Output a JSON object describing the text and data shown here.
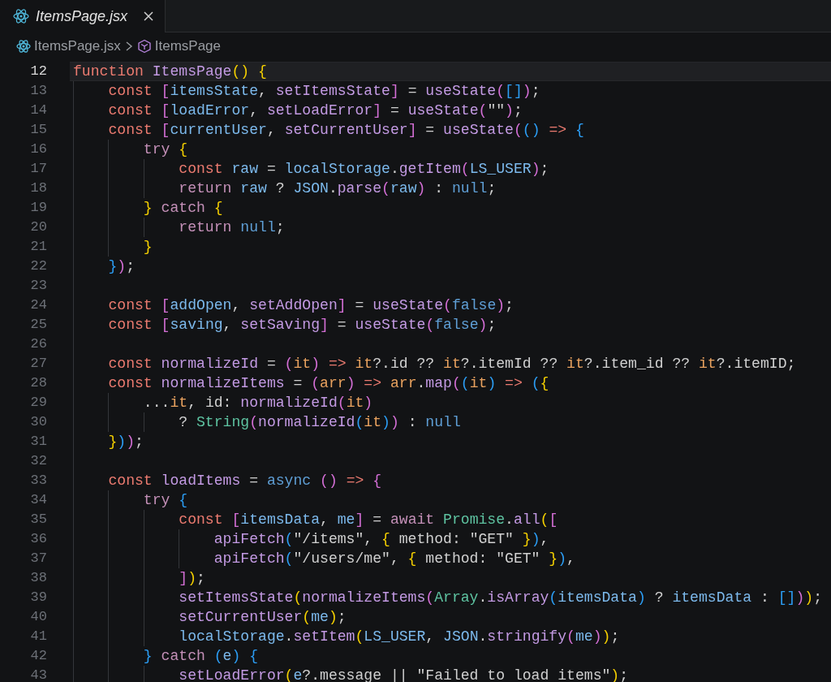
{
  "tab": {
    "title": "ItemsPage.jsx",
    "preview": true,
    "selected": true
  },
  "breadcrumb": [
    {
      "text": "ItemsPage.jsx",
      "kind": "file"
    },
    {
      "text": "ItemsPage",
      "kind": "function"
    }
  ],
  "editor": {
    "lines": [
      {
        "number": "12",
        "current": true,
        "tokens": [
          {
            "text": "function",
            "kind": "kw"
          },
          {
            "text": " ItemsPage",
            "kind": "fn"
          },
          {
            "text": "()",
            "kind": "b1"
          },
          {
            "text": " {",
            "kind": "b1"
          }
        ]
      },
      {
        "number": "13",
        "current": false,
        "tokens": [
          {
            "text": "    const",
            "kind": "kw"
          },
          {
            "text": " [",
            "kind": "b2"
          },
          {
            "text": "itemsState",
            "kind": "var"
          },
          {
            "text": ", ",
            "kind": "plain"
          },
          {
            "text": "setItemsState",
            "kind": "fn"
          },
          {
            "text": "]",
            "kind": "b2"
          },
          {
            "text": " = ",
            "kind": "plain"
          },
          {
            "text": "useState",
            "kind": "fn"
          },
          {
            "text": "(",
            "kind": "b2"
          },
          {
            "text": "[]",
            "kind": "b3"
          },
          {
            "text": ")",
            "kind": "b2"
          },
          {
            "text": ";",
            "kind": "plain"
          }
        ]
      },
      {
        "number": "14",
        "current": false,
        "tokens": [
          {
            "text": "    const",
            "kind": "kw"
          },
          {
            "text": " [",
            "kind": "b2"
          },
          {
            "text": "loadError",
            "kind": "var"
          },
          {
            "text": ", ",
            "kind": "plain"
          },
          {
            "text": "setLoadError",
            "kind": "fn"
          },
          {
            "text": "]",
            "kind": "b2"
          },
          {
            "text": " = ",
            "kind": "plain"
          },
          {
            "text": "useState",
            "kind": "fn"
          },
          {
            "text": "(",
            "kind": "b2"
          },
          {
            "text": "\"\"",
            "kind": "plain"
          },
          {
            "text": ")",
            "kind": "b2"
          },
          {
            "text": ";",
            "kind": "plain"
          }
        ]
      },
      {
        "number": "15",
        "current": false,
        "tokens": [
          {
            "text": "    const",
            "kind": "kw"
          },
          {
            "text": " [",
            "kind": "b2"
          },
          {
            "text": "currentUser",
            "kind": "var"
          },
          {
            "text": ", ",
            "kind": "plain"
          },
          {
            "text": "setCurrentUser",
            "kind": "fn"
          },
          {
            "text": "]",
            "kind": "b2"
          },
          {
            "text": " = ",
            "kind": "plain"
          },
          {
            "text": "useState",
            "kind": "fn"
          },
          {
            "text": "(",
            "kind": "b2"
          },
          {
            "text": "()",
            "kind": "b3"
          },
          {
            "text": " => ",
            "kind": "kw"
          },
          {
            "text": "{",
            "kind": "b3"
          }
        ]
      },
      {
        "number": "16",
        "current": false,
        "tokens": [
          {
            "text": "        try",
            "kind": "ctl"
          },
          {
            "text": " {",
            "kind": "b1"
          }
        ]
      },
      {
        "number": "17",
        "current": false,
        "tokens": [
          {
            "text": "            const",
            "kind": "kw"
          },
          {
            "text": " raw",
            "kind": "var"
          },
          {
            "text": " = ",
            "kind": "plain"
          },
          {
            "text": "localStorage",
            "kind": "var"
          },
          {
            "text": ".",
            "kind": "plain"
          },
          {
            "text": "getItem",
            "kind": "fn"
          },
          {
            "text": "(",
            "kind": "b2"
          },
          {
            "text": "LS_USER",
            "kind": "var"
          },
          {
            "text": ")",
            "kind": "b2"
          },
          {
            "text": ";",
            "kind": "plain"
          }
        ]
      },
      {
        "number": "18",
        "current": false,
        "tokens": [
          {
            "text": "            return",
            "kind": "ctl"
          },
          {
            "text": " raw",
            "kind": "var"
          },
          {
            "text": " ? ",
            "kind": "plain"
          },
          {
            "text": "JSON",
            "kind": "var"
          },
          {
            "text": ".",
            "kind": "plain"
          },
          {
            "text": "parse",
            "kind": "fn"
          },
          {
            "text": "(",
            "kind": "b2"
          },
          {
            "text": "raw",
            "kind": "var"
          },
          {
            "text": ")",
            "kind": "b2"
          },
          {
            "text": " : ",
            "kind": "plain"
          },
          {
            "text": "null",
            "kind": "lit"
          },
          {
            "text": ";",
            "kind": "plain"
          }
        ]
      },
      {
        "number": "19",
        "current": false,
        "tokens": [
          {
            "text": "        }",
            "kind": "b1"
          },
          {
            "text": " catch",
            "kind": "ctl"
          },
          {
            "text": " {",
            "kind": "b1"
          }
        ]
      },
      {
        "number": "20",
        "current": false,
        "tokens": [
          {
            "text": "            return",
            "kind": "ctl"
          },
          {
            "text": " null",
            "kind": "lit"
          },
          {
            "text": ";",
            "kind": "plain"
          }
        ]
      },
      {
        "number": "21",
        "current": false,
        "tokens": [
          {
            "text": "        }",
            "kind": "b1"
          }
        ]
      },
      {
        "number": "22",
        "current": false,
        "tokens": [
          {
            "text": "    }",
            "kind": "b3"
          },
          {
            "text": ")",
            "kind": "b2"
          },
          {
            "text": ";",
            "kind": "plain"
          }
        ]
      },
      {
        "number": "23",
        "current": false
      },
      {
        "number": "24",
        "current": false,
        "tokens": [
          {
            "text": "    const",
            "kind": "kw"
          },
          {
            "text": " [",
            "kind": "b2"
          },
          {
            "text": "addOpen",
            "kind": "var"
          },
          {
            "text": ", ",
            "kind": "plain"
          },
          {
            "text": "setAddOpen",
            "kind": "fn"
          },
          {
            "text": "]",
            "kind": "b2"
          },
          {
            "text": " = ",
            "kind": "plain"
          },
          {
            "text": "useState",
            "kind": "fn"
          },
          {
            "text": "(",
            "kind": "b2"
          },
          {
            "text": "false",
            "kind": "lit"
          },
          {
            "text": ")",
            "kind": "b2"
          },
          {
            "text": ";",
            "kind": "plain"
          }
        ]
      },
      {
        "number": "25",
        "current": false,
        "tokens": [
          {
            "text": "    const",
            "kind": "kw"
          },
          {
            "text": " [",
            "kind": "b2"
          },
          {
            "text": "saving",
            "kind": "var"
          },
          {
            "text": ", ",
            "kind": "plain"
          },
          {
            "text": "setSaving",
            "kind": "fn"
          },
          {
            "text": "]",
            "kind": "b2"
          },
          {
            "text": " = ",
            "kind": "plain"
          },
          {
            "text": "useState",
            "kind": "fn"
          },
          {
            "text": "(",
            "kind": "b2"
          },
          {
            "text": "false",
            "kind": "lit"
          },
          {
            "text": ")",
            "kind": "b2"
          },
          {
            "text": ";",
            "kind": "plain"
          }
        ]
      },
      {
        "number": "26",
        "current": false
      },
      {
        "number": "27",
        "current": false,
        "tokens": [
          {
            "text": "    const",
            "kind": "kw"
          },
          {
            "text": " normalizeId",
            "kind": "fn"
          },
          {
            "text": " = ",
            "kind": "plain"
          },
          {
            "text": "(",
            "kind": "b2"
          },
          {
            "text": "it",
            "kind": "param"
          },
          {
            "text": ")",
            "kind": "b2"
          },
          {
            "text": " => ",
            "kind": "kw"
          },
          {
            "text": "it",
            "kind": "param"
          },
          {
            "text": "?.id ?? ",
            "kind": "plain"
          },
          {
            "text": "it",
            "kind": "param"
          },
          {
            "text": "?.itemId ?? ",
            "kind": "plain"
          },
          {
            "text": "it",
            "kind": "param"
          },
          {
            "text": "?.item_id ?? ",
            "kind": "plain"
          },
          {
            "text": "it",
            "kind": "param"
          },
          {
            "text": "?.itemID;",
            "kind": "plain"
          }
        ]
      },
      {
        "number": "28",
        "current": false,
        "tokens": [
          {
            "text": "    const",
            "kind": "kw"
          },
          {
            "text": " normalizeItems",
            "kind": "fn"
          },
          {
            "text": " = ",
            "kind": "plain"
          },
          {
            "text": "(",
            "kind": "b2"
          },
          {
            "text": "arr",
            "kind": "param"
          },
          {
            "text": ")",
            "kind": "b2"
          },
          {
            "text": " => ",
            "kind": "kw"
          },
          {
            "text": "arr",
            "kind": "param"
          },
          {
            "text": ".",
            "kind": "plain"
          },
          {
            "text": "map",
            "kind": "fn"
          },
          {
            "text": "(",
            "kind": "b2"
          },
          {
            "text": "(",
            "kind": "b3"
          },
          {
            "text": "it",
            "kind": "param"
          },
          {
            "text": ")",
            "kind": "b3"
          },
          {
            "text": " => ",
            "kind": "kw"
          },
          {
            "text": "(",
            "kind": "b3"
          },
          {
            "text": "{",
            "kind": "b1"
          }
        ]
      },
      {
        "number": "29",
        "current": false,
        "tokens": [
          {
            "text": "        ...",
            "kind": "plain"
          },
          {
            "text": "it",
            "kind": "param"
          },
          {
            "text": ", id: ",
            "kind": "plain"
          },
          {
            "text": "normalizeId",
            "kind": "fn"
          },
          {
            "text": "(",
            "kind": "b2"
          },
          {
            "text": "it",
            "kind": "param"
          },
          {
            "text": ")",
            "kind": "b2"
          }
        ]
      },
      {
        "number": "30",
        "current": false,
        "tokens": [
          {
            "text": "            ? ",
            "kind": "plain"
          },
          {
            "text": "String",
            "kind": "type"
          },
          {
            "text": "(",
            "kind": "b2"
          },
          {
            "text": "normalizeId",
            "kind": "fn"
          },
          {
            "text": "(",
            "kind": "b3"
          },
          {
            "text": "it",
            "kind": "param"
          },
          {
            "text": ")",
            "kind": "b3"
          },
          {
            "text": ")",
            "kind": "b2"
          },
          {
            "text": " : ",
            "kind": "plain"
          },
          {
            "text": "null",
            "kind": "lit"
          }
        ]
      },
      {
        "number": "31",
        "current": false,
        "tokens": [
          {
            "text": "    }",
            "kind": "b1"
          },
          {
            "text": ")",
            "kind": "b3"
          },
          {
            "text": ")",
            "kind": "b2"
          },
          {
            "text": ";",
            "kind": "plain"
          }
        ]
      },
      {
        "number": "32",
        "current": false
      },
      {
        "number": "33",
        "current": false,
        "tokens": [
          {
            "text": "    const",
            "kind": "kw"
          },
          {
            "text": " loadItems",
            "kind": "fn"
          },
          {
            "text": " = ",
            "kind": "plain"
          },
          {
            "text": "async",
            "kind": "lit"
          },
          {
            "text": " ()",
            "kind": "b2"
          },
          {
            "text": " => ",
            "kind": "kw"
          },
          {
            "text": "{",
            "kind": "b2"
          }
        ]
      },
      {
        "number": "34",
        "current": false,
        "tokens": [
          {
            "text": "        try",
            "kind": "ctl"
          },
          {
            "text": " {",
            "kind": "b3"
          }
        ]
      },
      {
        "number": "35",
        "current": false,
        "tokens": [
          {
            "text": "            const",
            "kind": "kw"
          },
          {
            "text": " [",
            "kind": "b2"
          },
          {
            "text": "itemsData",
            "kind": "var"
          },
          {
            "text": ", ",
            "kind": "plain"
          },
          {
            "text": "me",
            "kind": "var"
          },
          {
            "text": "]",
            "kind": "b2"
          },
          {
            "text": " = ",
            "kind": "plain"
          },
          {
            "text": "await",
            "kind": "ctl"
          },
          {
            "text": " Promise",
            "kind": "type"
          },
          {
            "text": ".",
            "kind": "plain"
          },
          {
            "text": "all",
            "kind": "fn"
          },
          {
            "text": "(",
            "kind": "b1"
          },
          {
            "text": "[",
            "kind": "b2"
          }
        ]
      },
      {
        "number": "36",
        "current": false,
        "tokens": [
          {
            "text": "                apiFetch",
            "kind": "fn"
          },
          {
            "text": "(",
            "kind": "b3"
          },
          {
            "text": "\"/items\", ",
            "kind": "plain"
          },
          {
            "text": "{",
            "kind": "b1"
          },
          {
            "text": " method: \"GET\" ",
            "kind": "plain"
          },
          {
            "text": "}",
            "kind": "b1"
          },
          {
            "text": ")",
            "kind": "b3"
          },
          {
            "text": ",",
            "kind": "plain"
          }
        ]
      },
      {
        "number": "37",
        "current": false,
        "tokens": [
          {
            "text": "                apiFetch",
            "kind": "fn"
          },
          {
            "text": "(",
            "kind": "b3"
          },
          {
            "text": "\"/users/me\", ",
            "kind": "plain"
          },
          {
            "text": "{",
            "kind": "b1"
          },
          {
            "text": " method: \"GET\" ",
            "kind": "plain"
          },
          {
            "text": "}",
            "kind": "b1"
          },
          {
            "text": ")",
            "kind": "b3"
          },
          {
            "text": ",",
            "kind": "plain"
          }
        ]
      },
      {
        "number": "38",
        "current": false,
        "tokens": [
          {
            "text": "            ]",
            "kind": "b2"
          },
          {
            "text": ")",
            "kind": "b1"
          },
          {
            "text": ";",
            "kind": "plain"
          }
        ]
      },
      {
        "number": "39",
        "current": false,
        "tokens": [
          {
            "text": "            setItemsState",
            "kind": "fn"
          },
          {
            "text": "(",
            "kind": "b1"
          },
          {
            "text": "normalizeItems",
            "kind": "fn"
          },
          {
            "text": "(",
            "kind": "b2"
          },
          {
            "text": "Array",
            "kind": "type"
          },
          {
            "text": ".",
            "kind": "plain"
          },
          {
            "text": "isArray",
            "kind": "fn"
          },
          {
            "text": "(",
            "kind": "b3"
          },
          {
            "text": "itemsData",
            "kind": "var"
          },
          {
            "text": ")",
            "kind": "b3"
          },
          {
            "text": " ? ",
            "kind": "plain"
          },
          {
            "text": "itemsData",
            "kind": "var"
          },
          {
            "text": " : ",
            "kind": "plain"
          },
          {
            "text": "[]",
            "kind": "b3"
          },
          {
            "text": ")",
            "kind": "b2"
          },
          {
            "text": ")",
            "kind": "b1"
          },
          {
            "text": ";",
            "kind": "plain"
          }
        ]
      },
      {
        "number": "40",
        "current": false,
        "tokens": [
          {
            "text": "            setCurrentUser",
            "kind": "fn"
          },
          {
            "text": "(",
            "kind": "b1"
          },
          {
            "text": "me",
            "kind": "var"
          },
          {
            "text": ")",
            "kind": "b1"
          },
          {
            "text": ";",
            "kind": "plain"
          }
        ]
      },
      {
        "number": "41",
        "current": false,
        "tokens": [
          {
            "text": "            localStorage",
            "kind": "var"
          },
          {
            "text": ".",
            "kind": "plain"
          },
          {
            "text": "setItem",
            "kind": "fn"
          },
          {
            "text": "(",
            "kind": "b1"
          },
          {
            "text": "LS_USER",
            "kind": "var"
          },
          {
            "text": ", ",
            "kind": "plain"
          },
          {
            "text": "JSON",
            "kind": "var"
          },
          {
            "text": ".",
            "kind": "plain"
          },
          {
            "text": "stringify",
            "kind": "fn"
          },
          {
            "text": "(",
            "kind": "b2"
          },
          {
            "text": "me",
            "kind": "var"
          },
          {
            "text": ")",
            "kind": "b2"
          },
          {
            "text": ")",
            "kind": "b1"
          },
          {
            "text": ";",
            "kind": "plain"
          }
        ]
      },
      {
        "number": "42",
        "current": false,
        "tokens": [
          {
            "text": "        }",
            "kind": "b3"
          },
          {
            "text": " catch",
            "kind": "ctl"
          },
          {
            "text": " (",
            "kind": "b3"
          },
          {
            "text": "e",
            "kind": "var"
          },
          {
            "text": ")",
            "kind": "b3"
          },
          {
            "text": " {",
            "kind": "b3"
          }
        ]
      },
      {
        "number": "43",
        "current": false,
        "tokens": [
          {
            "text": "            setLoadError",
            "kind": "fn"
          },
          {
            "text": "(",
            "kind": "b1"
          },
          {
            "text": "e",
            "kind": "var"
          },
          {
            "text": "?.message || \"Failed to load items\"",
            "kind": "plain"
          },
          {
            "text": ")",
            "kind": "b1"
          },
          {
            "text": ";",
            "kind": "plain"
          }
        ]
      }
    ]
  }
}
